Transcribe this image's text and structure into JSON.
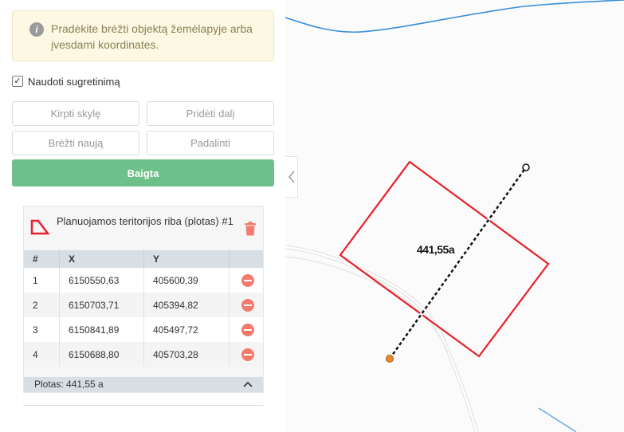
{
  "notice": {
    "text": "Pradėkite brėžti objektą žemėlapyje arba įvesdami koordinates."
  },
  "snapping": {
    "label": "Naudoti sugretinimą",
    "checked": true
  },
  "tools": {
    "cut_hole": "Kirpti skylę",
    "add_part": "Pridėti dalį",
    "draw_new": "Brėžti naują",
    "split": "Padalinti"
  },
  "done_label": "Baigta",
  "feature": {
    "title": "Planuojamos teritorijos riba (plotas) #1",
    "columns": [
      "#",
      "X",
      "Y"
    ],
    "rows": [
      {
        "n": "1",
        "x": "6150550,63",
        "y": "405600,39"
      },
      {
        "n": "2",
        "x": "6150703,71",
        "y": "405394,82"
      },
      {
        "n": "3",
        "x": "6150841,89",
        "y": "405497,72"
      },
      {
        "n": "4",
        "x": "6150688,80",
        "y": "405703,28"
      }
    ],
    "area_label": "Plotas: 441,55 a"
  },
  "map": {
    "measure_label": "441,55a"
  },
  "colors": {
    "polygon": "#e8202a",
    "done_button": "#6ec08a",
    "delete": "#f37a6c",
    "river": "#3a8fd8",
    "vertex_marker": "#e8892e"
  }
}
